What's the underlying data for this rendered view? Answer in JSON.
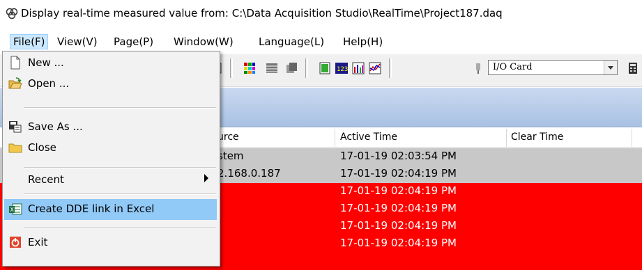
{
  "window": {
    "title": "Display real-time measured value from: C:\\Data Acquisition Studio\\RealTime\\Project187.daq"
  },
  "menubar": {
    "items": [
      {
        "label": "File(F)",
        "active": true
      },
      {
        "label": "View(V)"
      },
      {
        "label": "Page(P)"
      },
      {
        "label": "Window(W)"
      },
      {
        "label": "Language(L)"
      },
      {
        "label": "Help(H)"
      }
    ]
  },
  "toolbar": {
    "io_select": {
      "value": "I/O Card"
    }
  },
  "table": {
    "headers": [
      "urce",
      "Active Time",
      "Clear Time"
    ],
    "rows": [
      {
        "source": "stem",
        "active": "17-01-19 02:03:54 PM",
        "style": "gray"
      },
      {
        "source": "2.168.0.187",
        "active": "17-01-19 02:04:19 PM",
        "style": "gray"
      },
      {
        "source": "",
        "active": "17-01-19 02:04:19 PM",
        "style": "red"
      },
      {
        "source": "",
        "active": "17-01-19 02:04:19 PM",
        "style": "red"
      },
      {
        "source": "",
        "active": "17-01-19 02:04:19 PM",
        "style": "red"
      },
      {
        "source": "",
        "active": "17-01-19 02:04:19 PM",
        "style": "red"
      }
    ]
  },
  "file_menu": {
    "items": [
      {
        "label": "New ...",
        "icon": "new-file-icon"
      },
      {
        "label": "Open ...",
        "icon": "open-folder-icon"
      },
      {
        "label": "Save As ...",
        "icon": "save-as-icon"
      },
      {
        "label": "Close",
        "icon": "folder-icon"
      },
      {
        "label": "Recent",
        "icon": ""
      },
      {
        "label": "Create DDE link in Excel",
        "icon": "excel-link-icon",
        "highlighted": true
      },
      {
        "label": "Exit",
        "icon": "exit-icon"
      }
    ]
  },
  "colors": {
    "menu_highlight": "#91c9f7",
    "alarm_red": "#ff0000",
    "system_gray": "#c8c8c8"
  }
}
